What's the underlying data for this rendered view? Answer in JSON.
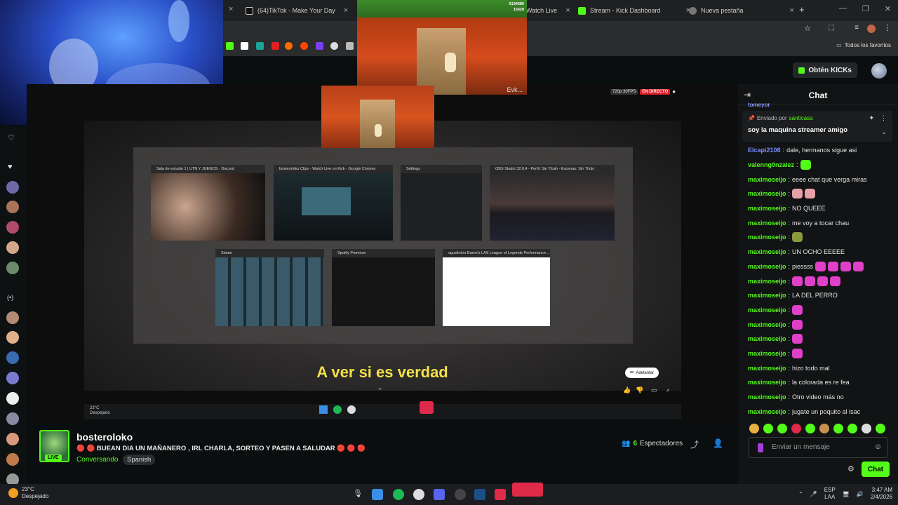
{
  "browser": {
    "tabs": [
      {
        "label": "(64)TikTok - Make Your Day",
        "icon": "tiktok-icon",
        "color": "#ffffff"
      },
      {
        "label": "Watch Live",
        "icon": "kick-icon",
        "color": "#53fc18"
      },
      {
        "label": "Stream - Kick Dashboard",
        "icon": "kick-icon",
        "color": "#53fc18"
      },
      {
        "label": "Nueva pestaña",
        "icon": "globe-icon",
        "color": "#aaaaaa"
      }
    ],
    "new_tab": "+",
    "favorites_label": "Todos los favoritos"
  },
  "kick_header": {
    "obtain_label": "Obtén KICKs"
  },
  "game": {
    "score_top": "5134580",
    "score_bottom": "15628",
    "caption": "Evk..."
  },
  "video": {
    "quality": "720p 30FPS",
    "live_label": "EN DIRECTO",
    "subtitle": "A ver si es verdad",
    "skip_label": "Adelantar",
    "windows": [
      {
        "title": "Sala de estudio 1 | UTN Y JUEGOS - Discord"
      },
      {
        "title": "bosteroloko Clips - Watch Live on Kick - Google Chrome"
      },
      {
        "title": "Settings"
      },
      {
        "title": "OBS Studio 32.0.4 - Perfil: Sin Título - Escenas: Sin Título"
      },
      {
        "title": "Steam"
      },
      {
        "title": "Spotify Premium"
      },
      {
        "title": "aguslindro Baron's LAS League of Legends Performance..."
      }
    ],
    "inner_weather": "23°C",
    "inner_weather_desc": "Despejado"
  },
  "stream_info": {
    "streamer": "bosteroloko",
    "live_tag": "LIVE",
    "title": "🔴 🔴 BUEAN DIA UN MAÑANERO , IRL CHARLA, SORTEO Y PASEN A SALUDAR 🔴 🔴 🔴",
    "category": "Conversando",
    "language": "Spanish",
    "viewers_count": "6",
    "viewers_label": "Espectadores"
  },
  "chat": {
    "title": "Chat",
    "top_cut": "tomeyor",
    "pinned": {
      "sent_by_label": "Enviado por",
      "sender": "santicasa",
      "message": "soy la maquina streamer amigo"
    },
    "messages": [
      {
        "user": "Elcapi2108",
        "color": "#7b8cff",
        "text": "dale, hermanos sigue asi",
        "emotes": 0,
        "emote_color": ""
      },
      {
        "user": "valenng0nzalez",
        "color": "#53fc18",
        "text": "",
        "emotes": 1,
        "emote_color": "#53fc18"
      },
      {
        "user": "maximoseijo",
        "color": "#53fc18",
        "text": "eeee chat que verga miras",
        "emotes": 0,
        "emote_color": ""
      },
      {
        "user": "maximoseijo",
        "color": "#53fc18",
        "text": "",
        "emotes": 2,
        "emote_color": "#e8a0a8"
      },
      {
        "user": "maximoseijo",
        "color": "#53fc18",
        "text": "NO QUEEE",
        "emotes": 0,
        "emote_color": ""
      },
      {
        "user": "maximoseijo",
        "color": "#53fc18",
        "text": "me voy a tocar chau",
        "emotes": 0,
        "emote_color": ""
      },
      {
        "user": "maximoseijo",
        "color": "#53fc18",
        "text": "",
        "emotes": 1,
        "emote_color": "#8a9a3a"
      },
      {
        "user": "maximoseijo",
        "color": "#53fc18",
        "text": "UN OCHO EEEEE",
        "emotes": 0,
        "emote_color": ""
      },
      {
        "user": "maximoseijo",
        "color": "#53fc18",
        "text": "piessss",
        "emotes": 4,
        "emote_color": "#e040c8"
      },
      {
        "user": "maximoseijo",
        "color": "#53fc18",
        "text": "",
        "emotes": 4,
        "emote_color": "#e040c8"
      },
      {
        "user": "maximoseijo",
        "color": "#53fc18",
        "text": "LA DEL PERRO",
        "emotes": 0,
        "emote_color": ""
      },
      {
        "user": "maximoseijo",
        "color": "#53fc18",
        "text": "",
        "emotes": 1,
        "emote_color": "#e040c8"
      },
      {
        "user": "maximoseijo",
        "color": "#53fc18",
        "text": "",
        "emotes": 1,
        "emote_color": "#e040c8"
      },
      {
        "user": "maximoseijo",
        "color": "#53fc18",
        "text": "",
        "emotes": 1,
        "emote_color": "#e040c8"
      },
      {
        "user": "maximoseijo",
        "color": "#53fc18",
        "text": "",
        "emotes": 1,
        "emote_color": "#e040c8"
      },
      {
        "user": "maximoseijo",
        "color": "#53fc18",
        "text": "hizo todo mal",
        "emotes": 0,
        "emote_color": ""
      },
      {
        "user": "maximoseijo",
        "color": "#53fc18",
        "text": "la colorada es re fea",
        "emotes": 0,
        "emote_color": ""
      },
      {
        "user": "maximoseijo",
        "color": "#53fc18",
        "text": "Otro video más no",
        "emotes": 0,
        "emote_color": ""
      },
      {
        "user": "maximoseijo",
        "color": "#53fc18",
        "text": "jugate un poquito al isac",
        "emotes": 0,
        "emote_color": ""
      }
    ],
    "input_placeholder": "Enviar un mensaje",
    "send_label": "Chat"
  },
  "taskbar": {
    "temperature": "23°C",
    "weather": "Despejado",
    "lang_top": "ESP",
    "lang_bottom": "LAA",
    "time": "3:47 AM",
    "date": "2/4/2026"
  },
  "colors": {
    "kick_green": "#53fc18",
    "live_red": "#e0202a",
    "subtitle_yellow": "#f1e04a"
  }
}
